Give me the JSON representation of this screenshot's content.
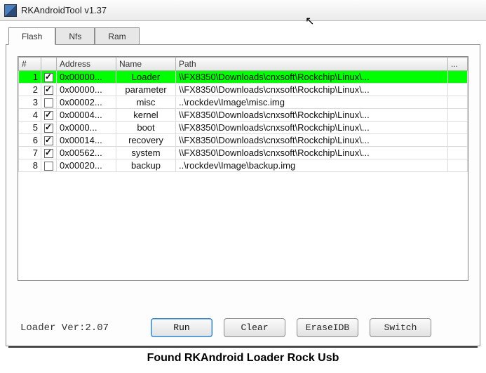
{
  "window": {
    "title": "RKAndroidTool v1.37"
  },
  "tabs": [
    {
      "label": "Flash",
      "active": true
    },
    {
      "label": "Nfs",
      "active": false
    },
    {
      "label": "Ram",
      "active": false
    }
  ],
  "columns": {
    "num": "#",
    "chk": "",
    "address": "Address",
    "name": "Name",
    "path": "Path",
    "more": "..."
  },
  "rows": [
    {
      "num": "1",
      "checked": true,
      "selected": true,
      "address": "0x00000...",
      "name": "Loader",
      "path": "\\\\FX8350\\Downloads\\cnxsoft\\Rockchip\\Linux\\..."
    },
    {
      "num": "2",
      "checked": true,
      "selected": false,
      "address": "0x00000...",
      "name": "parameter",
      "path": "\\\\FX8350\\Downloads\\cnxsoft\\Rockchip\\Linux\\..."
    },
    {
      "num": "3",
      "checked": false,
      "selected": false,
      "address": "0x00002...",
      "name": "misc",
      "path": "..\\rockdev\\Image\\misc.img"
    },
    {
      "num": "4",
      "checked": true,
      "selected": false,
      "address": "0x00004...",
      "name": "kernel",
      "path": "\\\\FX8350\\Downloads\\cnxsoft\\Rockchip\\Linux\\..."
    },
    {
      "num": "5",
      "checked": true,
      "selected": false,
      "address": "0x0000...",
      "name": "boot",
      "path": "\\\\FX8350\\Downloads\\cnxsoft\\Rockchip\\Linux\\..."
    },
    {
      "num": "6",
      "checked": true,
      "selected": false,
      "address": "0x00014...",
      "name": "recovery",
      "path": "\\\\FX8350\\Downloads\\cnxsoft\\Rockchip\\Linux\\..."
    },
    {
      "num": "7",
      "checked": true,
      "selected": false,
      "address": "0x00562...",
      "name": "system",
      "path": "\\\\FX8350\\Downloads\\cnxsoft\\Rockchip\\Linux\\..."
    },
    {
      "num": "8",
      "checked": false,
      "selected": false,
      "address": "0x00020...",
      "name": "backup",
      "path": "..\\rockdev\\Image\\backup.img"
    }
  ],
  "loader_ver": "Loader Ver:2.07",
  "buttons": {
    "run": "Run",
    "clear": "Clear",
    "eraseidb": "EraseIDB",
    "switch": "Switch"
  },
  "status": "Found RKAndroid Loader Rock Usb"
}
